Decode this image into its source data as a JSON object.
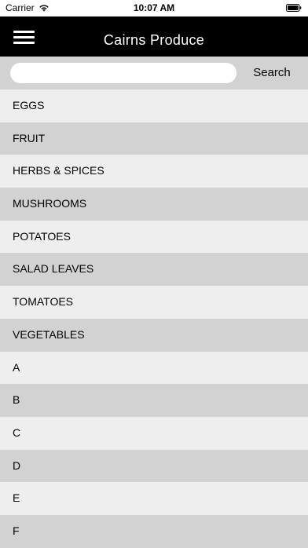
{
  "status_bar": {
    "carrier": "Carrier",
    "time": "10:07 AM",
    "wifi_icon": "wifi-icon",
    "battery_icon": "battery-icon"
  },
  "nav": {
    "title": "Cairns Produce",
    "menu_icon": "hamburger-menu-icon"
  },
  "search": {
    "value": "",
    "placeholder": "",
    "button_label": "Search"
  },
  "categories": [
    "EGGS",
    "FRUIT",
    "HERBS & SPICES",
    "MUSHROOMS",
    "POTATOES",
    "SALAD LEAVES",
    "TOMATOES",
    "VEGETABLES",
    "A",
    "B",
    "C",
    "D",
    "E",
    "F"
  ],
  "colors": {
    "nav_background": "#000000",
    "row_light": "#eeeeee",
    "row_dark": "#d2d2d2",
    "search_bar_background": "#d2d2d2"
  }
}
